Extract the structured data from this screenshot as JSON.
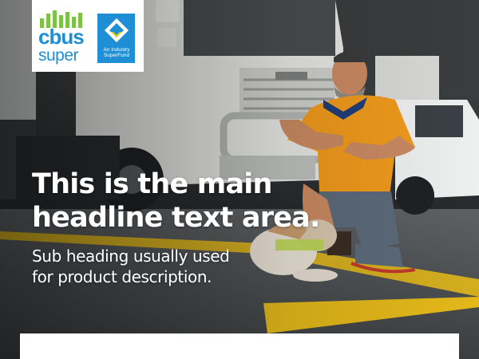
{
  "brand": {
    "name_line1": "cbus",
    "name_line2": "super",
    "badge_line1": "An Industry",
    "badge_line2": "SuperFund",
    "colors": {
      "logo_blue": "#1e8fd4",
      "logo_green": "#7cc244",
      "badge_blue": "#1e8fd4"
    },
    "icons": [
      "cbus-bars-icon",
      "industry-superfund-diamond-icon"
    ]
  },
  "hero": {
    "headline_line1": "This is the main",
    "headline_line2": "headline text area.",
    "subheading_line1": "Sub heading usually used",
    "subheading_line2": "for product description."
  },
  "colors": {
    "text": "#ffffff",
    "road_marking": "#e3b81a",
    "card": "#ffffff"
  }
}
